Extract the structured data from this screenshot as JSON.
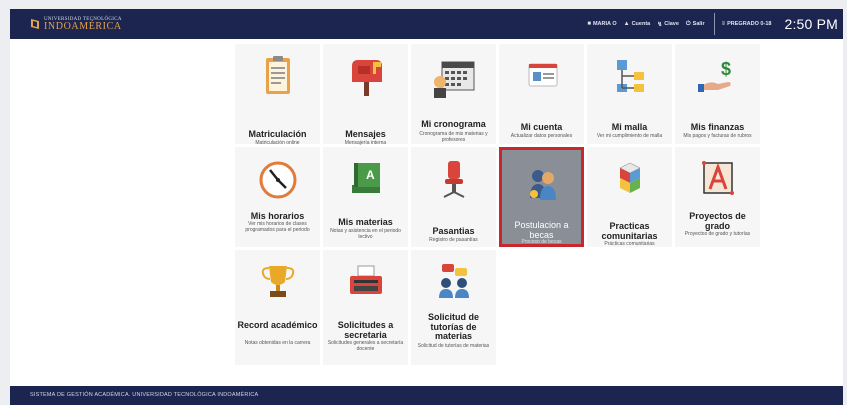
{
  "header": {
    "logo_sub": "UNIVERSIDAD TECNOLÓGICA",
    "logo_main": "INDOAMÉRICA",
    "user_label": "MARIA O",
    "nav_items": [
      {
        "label": "Cuenta",
        "icon": "person-icon"
      },
      {
        "label": "Clave",
        "icon": "key-icon"
      },
      {
        "label": "Salir",
        "icon": "power-icon"
      }
    ],
    "program_label": "PREGRADO 0-18",
    "clock": "2:50 PM"
  },
  "tiles": [
    {
      "id": "matriculacion",
      "title": "Matriculación",
      "desc": "Matriculación online",
      "icon": "clipboard-icon"
    },
    {
      "id": "mensajes",
      "title": "Mensajes",
      "desc": "Mensajería interna",
      "icon": "mailbox-icon"
    },
    {
      "id": "mi-cronograma",
      "title": "Mi cronograma",
      "desc": "Cronograma de mis materias y profesores",
      "icon": "calendar-icon"
    },
    {
      "id": "mi-cuenta",
      "title": "Mi cuenta",
      "desc": "Actualizar datos personales",
      "icon": "id-card-icon"
    },
    {
      "id": "mi-malla",
      "title": "Mi malla",
      "desc": "Ver mi cumplimiento de malla",
      "icon": "flowchart-icon"
    },
    {
      "id": "mis-finanzas",
      "title": "Mis finanzas",
      "desc": "Mis pagos y facturas de rubros",
      "icon": "money-hand-icon"
    },
    {
      "id": "mis-horarios",
      "title": "Mis horarios",
      "desc": "Ver mis horarios de clases programados para el periodo",
      "icon": "clock-icon"
    },
    {
      "id": "mis-materias",
      "title": "Mis materias",
      "desc": "Notas y asistencia en el periodo lectivo",
      "icon": "book-icon"
    },
    {
      "id": "pasantias",
      "title": "Pasantias",
      "desc": "Registro de pasantías",
      "icon": "chair-icon"
    },
    {
      "id": "postulacion-becas",
      "title": "Postulacion a becas",
      "desc": "Proceso de becas",
      "icon": "scholarship-icon"
    },
    {
      "id": "practicas-comunitarias",
      "title": "Practicas comunitarias",
      "desc": "Prácticas comunitarias",
      "icon": "cubes-icon"
    },
    {
      "id": "proyectos-grado",
      "title": "Proyectos de grado",
      "desc": "Proyectos de grado y tutorías",
      "icon": "letter-a-icon"
    },
    {
      "id": "record-academico",
      "title": "Record académico",
      "desc": "Notas obtenidas en la carrera",
      "icon": "trophy-icon"
    },
    {
      "id": "solicitudes-secretaria",
      "title": "Solicitudes a secretaria",
      "desc": "Solicitudes generales a secretaría docente",
      "icon": "typewriter-icon"
    },
    {
      "id": "solicitud-tutorias",
      "title": "Solicitud de tutorías de materias",
      "desc": "Solicitud de tutorías de materias",
      "icon": "tutoring-icon"
    }
  ],
  "footer": {
    "line1": "SISTEMA DE GESTIÓN ACADÉMICA. UNIVERSIDAD TECNOLÓGICA INDOAMÉRICA"
  },
  "colors": {
    "header_bg": "#1b2550",
    "logo_accent": "#e6a34a",
    "active_tile_bg": "#8a8e96",
    "active_tile_border": "#c6282d"
  }
}
